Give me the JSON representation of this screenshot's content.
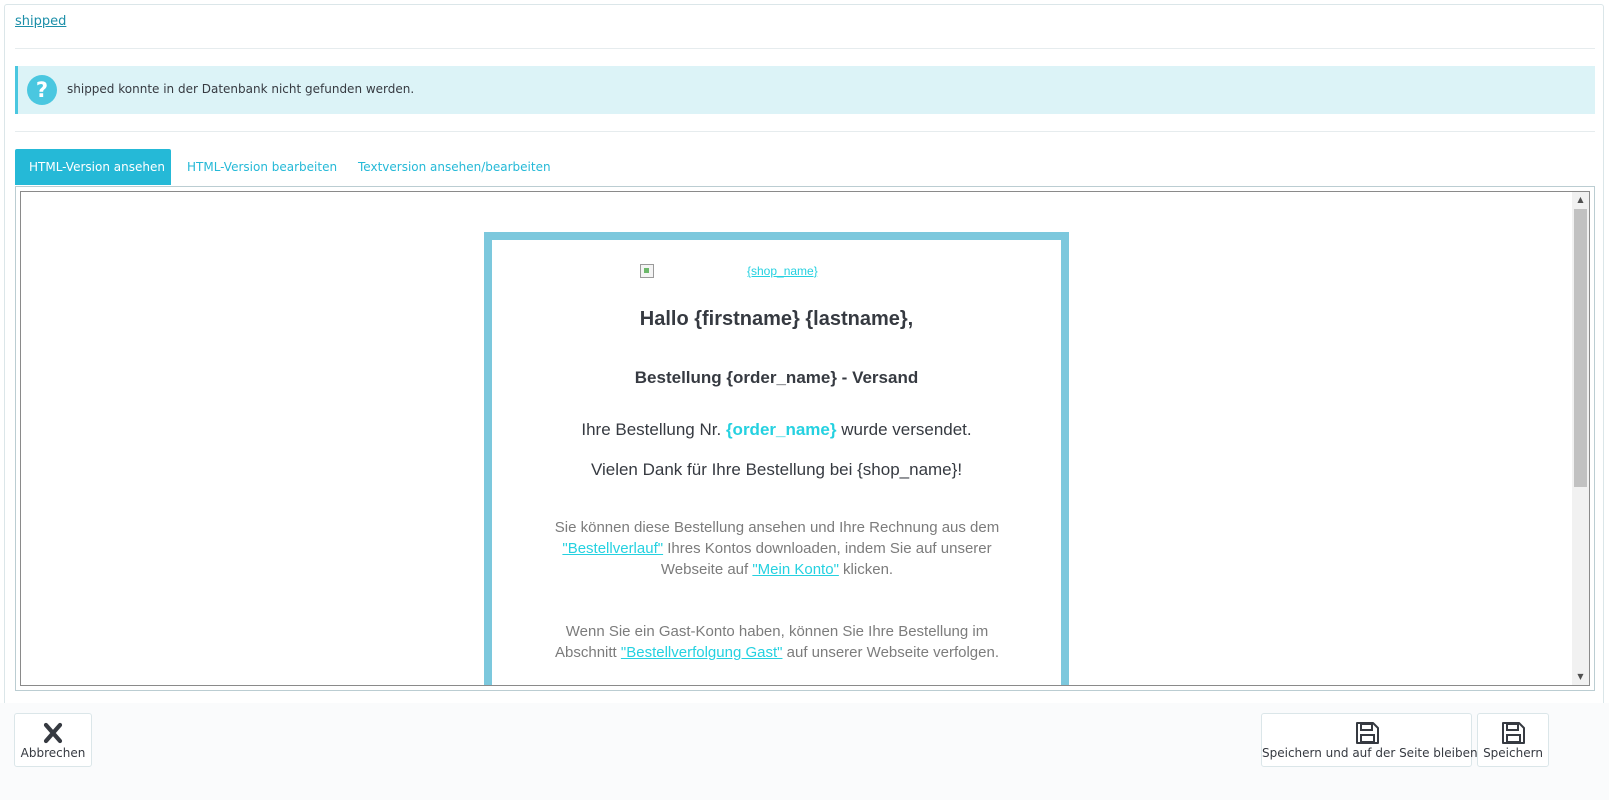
{
  "template": {
    "name_link": "shipped"
  },
  "alert": {
    "icon": "question-circle-icon",
    "message": "shipped konnte in der Datenbank nicht gefunden werden."
  },
  "tabs": [
    {
      "label": "HTML-Version ansehen",
      "active": true
    },
    {
      "label": "HTML-Version bearbeiten",
      "active": false
    },
    {
      "label": "Textversion ansehen/bearbeiten",
      "active": false
    }
  ],
  "preview": {
    "logo_alt": "{shop_name}",
    "greeting": "Hallo {firstname} {lastname},",
    "subject": "Bestellung {order_name} - Versand",
    "order_line_prefix": "Ihre Bestellung Nr. ",
    "order_ref": "{order_name}",
    "order_line_suffix": " wurde versendet.",
    "thanks": "Vielen Dank für Ihre Bestellung bei {shop_name}!",
    "para1_a": "Sie können diese Bestellung ansehen und Ihre Rechnung aus dem ",
    "para1_link1": "\"Bestellverlauf\"",
    "para1_b": " Ihres Kontos downloaden, indem Sie auf unserer Webseite auf ",
    "para1_link2": "\"Mein Konto\"",
    "para1_c": " klicken.",
    "para2_a": "Wenn Sie ein Gast-Konto haben, können Sie Ihre Bestellung im Abschnitt ",
    "para2_link": "\"Bestellverfolgung Gast\"",
    "para2_b": " auf unserer Webseite verfolgen."
  },
  "footer": {
    "cancel_label": "Abbrechen",
    "save_stay_label": "Speichern und auf der Seite bleiben",
    "save_label": "Speichern"
  },
  "colors": {
    "accent": "#25b9d7",
    "email_border": "#7cc8dd",
    "alert_bg": "#dcf3f7",
    "link": "#25d1e0"
  }
}
